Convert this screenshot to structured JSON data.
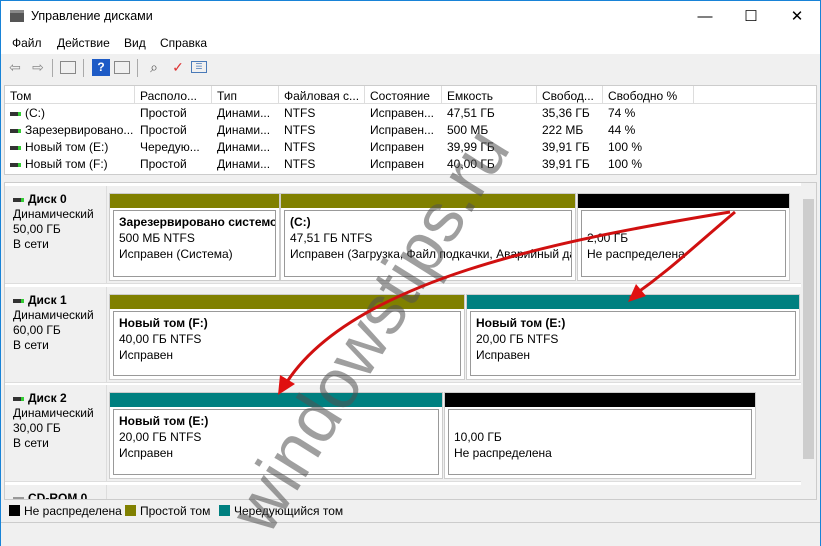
{
  "window": {
    "title": "Управление дисками",
    "minimize": "—",
    "maximize": "☐",
    "close": "✕"
  },
  "menu": [
    "Файл",
    "Действие",
    "Вид",
    "Справка"
  ],
  "toolbar": [
    "back-icon",
    "forward-icon",
    "console-tree-icon",
    "help-icon",
    "action-pane-icon",
    "connect-disk-icon",
    "check-icon",
    "properties-icon"
  ],
  "volumes": {
    "columns": [
      "Том",
      "Располо...",
      "Тип",
      "Файловая с...",
      "Состояние",
      "Емкость",
      "Свобод...",
      "Свободно %"
    ],
    "rows": [
      [
        "(C:)",
        "Простой",
        "Динами...",
        "NTFS",
        "Исправен...",
        "47,51 ГБ",
        "35,36 ГБ",
        "74 %"
      ],
      [
        "Зарезервировано...",
        "Простой",
        "Динами...",
        "NTFS",
        "Исправен...",
        "500 МБ",
        "222 МБ",
        "44 %"
      ],
      [
        "Новый том (E:)",
        "Чередую...",
        "Динами...",
        "NTFS",
        "Исправен",
        "39,99 ГБ",
        "39,91 ГБ",
        "100 %"
      ],
      [
        "Новый том (F:)",
        "Простой",
        "Динами...",
        "NTFS",
        "Исправен",
        "40,00 ГБ",
        "39,91 ГБ",
        "100 %"
      ]
    ]
  },
  "disks": [
    {
      "name": "Диск 0",
      "type": "Динамический",
      "size": "50,00 ГБ",
      "status": "В сети",
      "partitions": [
        {
          "title": "Зарезервировано системо",
          "size": "500 МБ NTFS",
          "status": "Исправен (Система)",
          "color": "#808000"
        },
        {
          "title": "(C:)",
          "size": "47,51 ГБ NTFS",
          "status": "Исправен (Загрузка, Файл подкачки, Аварийный да",
          "color": "#808000"
        },
        {
          "title": "",
          "size": "2,00 ГБ",
          "status": "Не распределена",
          "color": "#000000"
        }
      ]
    },
    {
      "name": "Диск 1",
      "type": "Динамический",
      "size": "60,00 ГБ",
      "status": "В сети",
      "partitions": [
        {
          "title": "Новый том  (F:)",
          "size": "40,00 ГБ NTFS",
          "status": "Исправен",
          "color": "#808000"
        },
        {
          "title": "Новый том  (E:)",
          "size": "20,00 ГБ NTFS",
          "status": "Исправен",
          "color": "#008080"
        }
      ]
    },
    {
      "name": "Диск 2",
      "type": "Динамический",
      "size": "30,00 ГБ",
      "status": "В сети",
      "partitions": [
        {
          "title": "Новый том  (E:)",
          "size": "20,00 ГБ NTFS",
          "status": "Исправен",
          "color": "#008080"
        },
        {
          "title": "",
          "size": "10,00 ГБ",
          "status": "Не распределена",
          "color": "#000000"
        }
      ]
    },
    {
      "name": "CD-ROM 0"
    }
  ],
  "legend": [
    {
      "label": "Не распределена",
      "color": "#000000"
    },
    {
      "label": "Простой том",
      "color": "#808000"
    },
    {
      "label": "Чередующийся том",
      "color": "#008080"
    }
  ],
  "watermark": "windowstips.ru"
}
